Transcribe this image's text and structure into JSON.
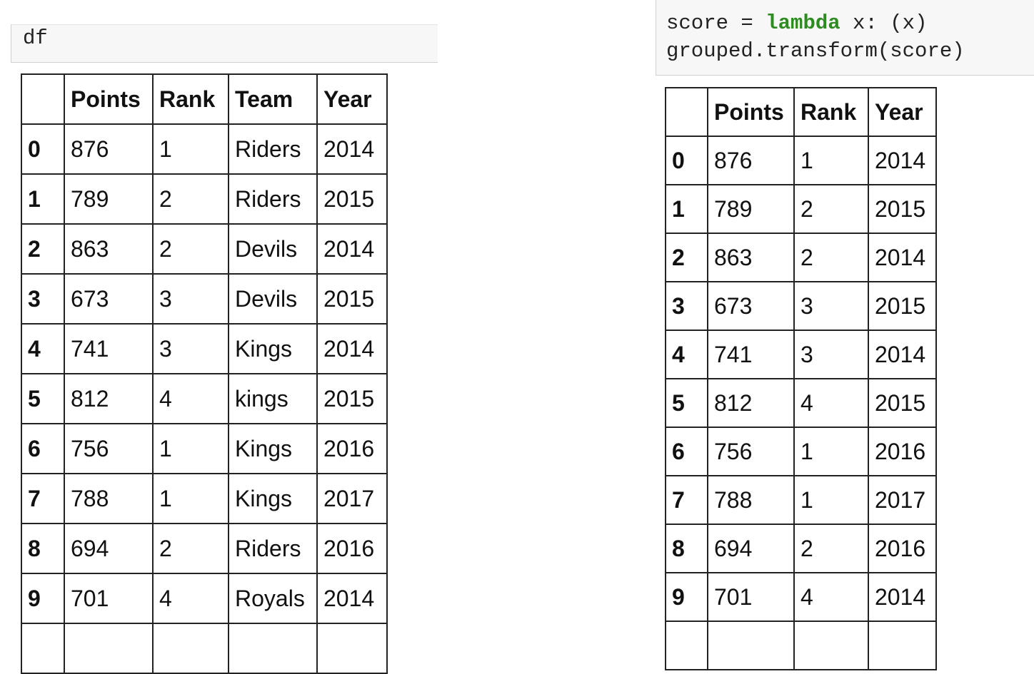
{
  "left_cell": {
    "code": "df"
  },
  "right_cell": {
    "line1_prefix": "score = ",
    "line1_keyword": "lambda",
    "line1_suffix": " x: (x)",
    "line2": "grouped.transform(score)"
  },
  "left_table": {
    "columns": [
      "Points",
      "Rank",
      "Team",
      "Year"
    ],
    "rows": [
      {
        "index": "0",
        "values": [
          "876",
          "1",
          "Riders",
          "2014"
        ]
      },
      {
        "index": "1",
        "values": [
          "789",
          "2",
          "Riders",
          "2015"
        ]
      },
      {
        "index": "2",
        "values": [
          "863",
          "2",
          "Devils",
          "2014"
        ]
      },
      {
        "index": "3",
        "values": [
          "673",
          "3",
          "Devils",
          "2015"
        ]
      },
      {
        "index": "4",
        "values": [
          "741",
          "3",
          "Kings",
          "2014"
        ]
      },
      {
        "index": "5",
        "values": [
          "812",
          "4",
          "kings",
          "2015"
        ]
      },
      {
        "index": "6",
        "values": [
          "756",
          "1",
          "Kings",
          "2016"
        ]
      },
      {
        "index": "7",
        "values": [
          "788",
          "1",
          "Kings",
          "2017"
        ]
      },
      {
        "index": "8",
        "values": [
          "694",
          "2",
          "Riders",
          "2016"
        ]
      },
      {
        "index": "9",
        "values": [
          "701",
          "4",
          "Royals",
          "2014"
        ]
      }
    ]
  },
  "right_table": {
    "columns": [
      "Points",
      "Rank",
      "Year"
    ],
    "rows": [
      {
        "index": "0",
        "values": [
          "876",
          "1",
          "2014"
        ]
      },
      {
        "index": "1",
        "values": [
          "789",
          "2",
          "2015"
        ]
      },
      {
        "index": "2",
        "values": [
          "863",
          "2",
          "2014"
        ]
      },
      {
        "index": "3",
        "values": [
          "673",
          "3",
          "2015"
        ]
      },
      {
        "index": "4",
        "values": [
          "741",
          "3",
          "2014"
        ]
      },
      {
        "index": "5",
        "values": [
          "812",
          "4",
          "2015"
        ]
      },
      {
        "index": "6",
        "values": [
          "756",
          "1",
          "2016"
        ]
      },
      {
        "index": "7",
        "values": [
          "788",
          "1",
          "2017"
        ]
      },
      {
        "index": "8",
        "values": [
          "694",
          "2",
          "2016"
        ]
      },
      {
        "index": "9",
        "values": [
          "701",
          "4",
          "2014"
        ]
      }
    ]
  }
}
